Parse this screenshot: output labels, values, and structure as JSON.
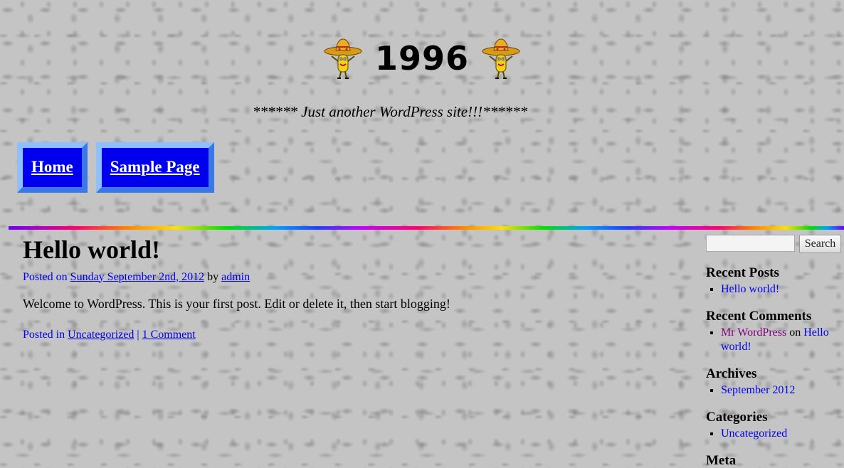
{
  "site": {
    "title": "1996",
    "tagline": "****** Just another WordPress site!!!******"
  },
  "nav": [
    {
      "label": "Home"
    },
    {
      "label": "Sample Page"
    }
  ],
  "post": {
    "title": "Hello world!",
    "posted_on_label": "Posted on",
    "date": "Sunday September 2nd, 2012",
    "by_label": "by",
    "author": "admin",
    "body": "Welcome to WordPress. This is your first post. Edit or delete it, then start blogging!",
    "posted_in_label": "Posted in",
    "category": "Uncategorized",
    "separator": "|",
    "comments": "1 Comment"
  },
  "sidebar": {
    "search": {
      "value": "",
      "button": "Search"
    },
    "recent_posts": {
      "title": "Recent Posts",
      "items": [
        "Hello world!"
      ]
    },
    "recent_comments": {
      "title": "Recent Comments",
      "items": [
        {
          "author": "Mr WordPress",
          "on": "on",
          "post": "Hello world!"
        }
      ]
    },
    "archives": {
      "title": "Archives",
      "items": [
        "September 2012"
      ]
    },
    "categories": {
      "title": "Categories",
      "items": [
        "Uncategorized"
      ]
    },
    "meta": {
      "title": "Meta"
    }
  },
  "colors": {
    "link": "#0000ee",
    "visited": "#800080",
    "nav_button": "#0000ee",
    "background": "#c4c4c4"
  },
  "icons": [
    "sombrero-icon"
  ]
}
